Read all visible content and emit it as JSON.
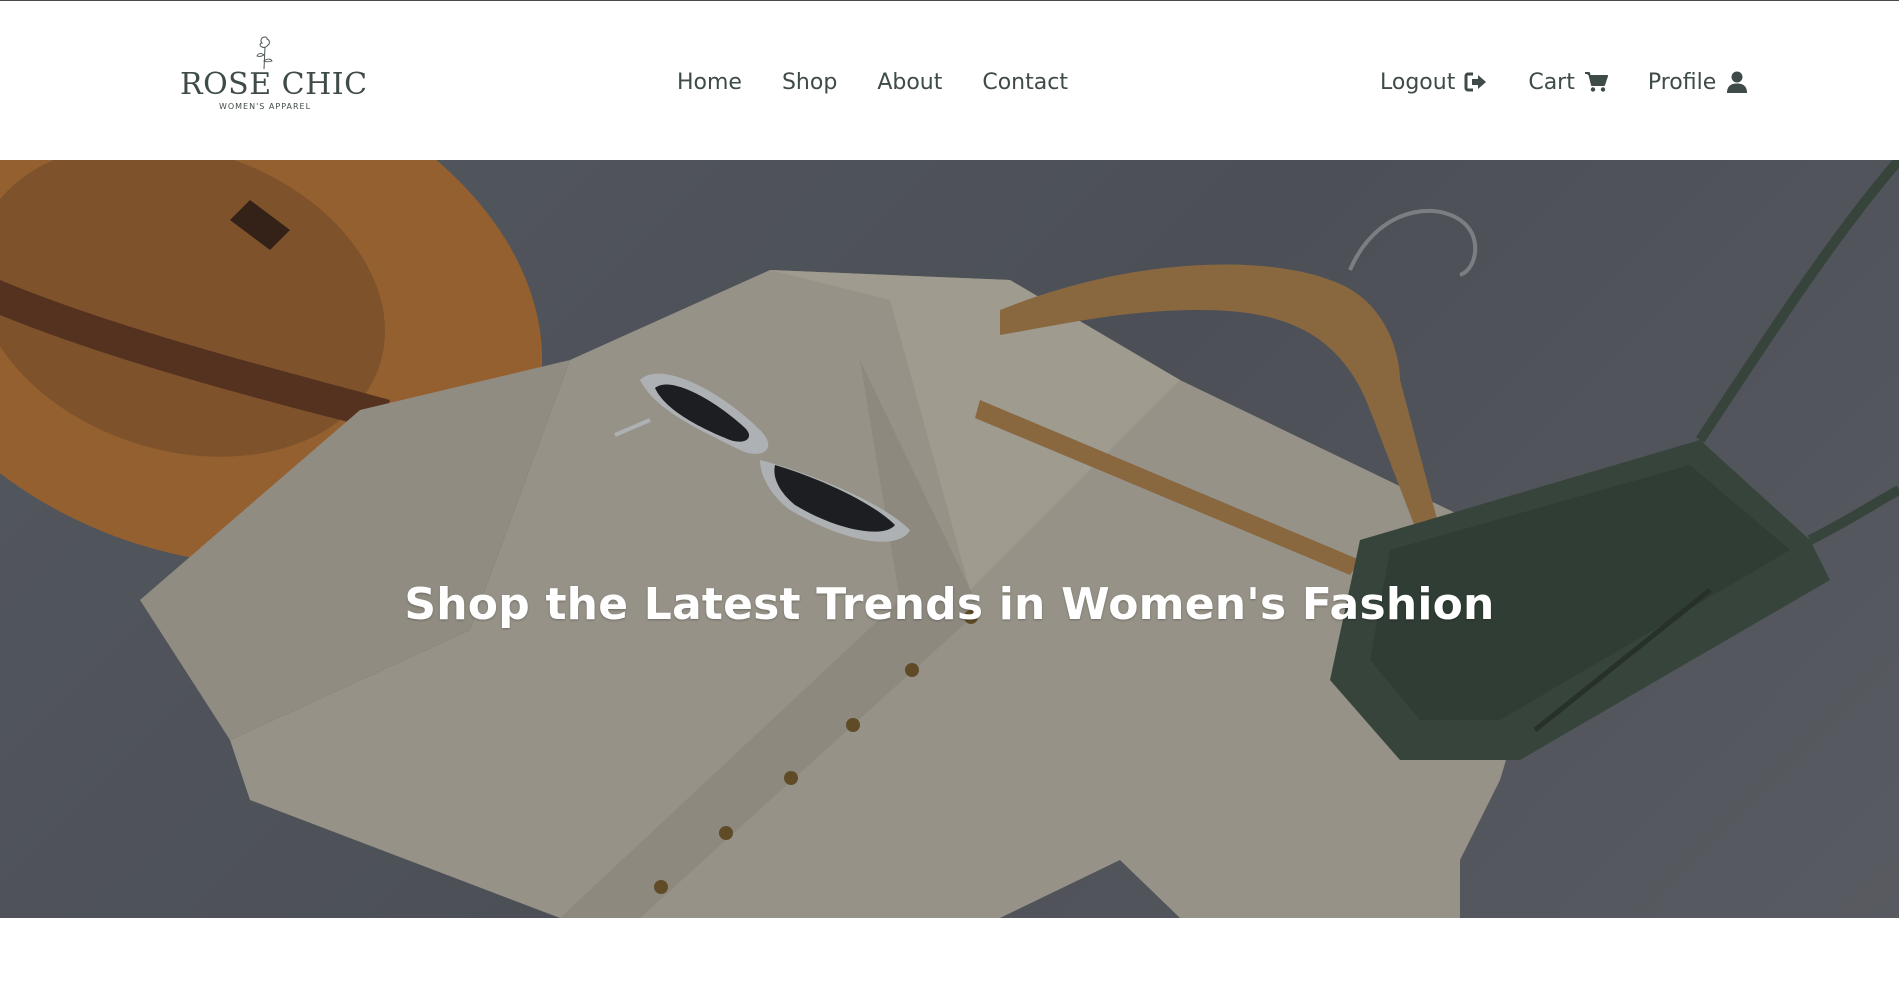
{
  "brand": {
    "name": "ROSE CHIC",
    "tagline": "WOMEN'S APPAREL",
    "icon": "rose-icon"
  },
  "nav": {
    "items": [
      {
        "label": "Home"
      },
      {
        "label": "Shop"
      },
      {
        "label": "About"
      },
      {
        "label": "Contact"
      }
    ]
  },
  "user_nav": {
    "logout": {
      "label": "Logout",
      "icon": "sign-out-icon"
    },
    "cart": {
      "label": "Cart",
      "icon": "shopping-cart-icon"
    },
    "profile": {
      "label": "Profile",
      "icon": "user-icon"
    }
  },
  "hero": {
    "title": "Shop the Latest Trends in Women's Fashion",
    "image_items": [
      "hat",
      "sunglasses",
      "hanger",
      "cardigan",
      "crossbody-bag"
    ]
  },
  "colors": {
    "nav_text": "#3e4b49",
    "hero_background": "#5a5e64",
    "hero_text": "#ffffff"
  }
}
